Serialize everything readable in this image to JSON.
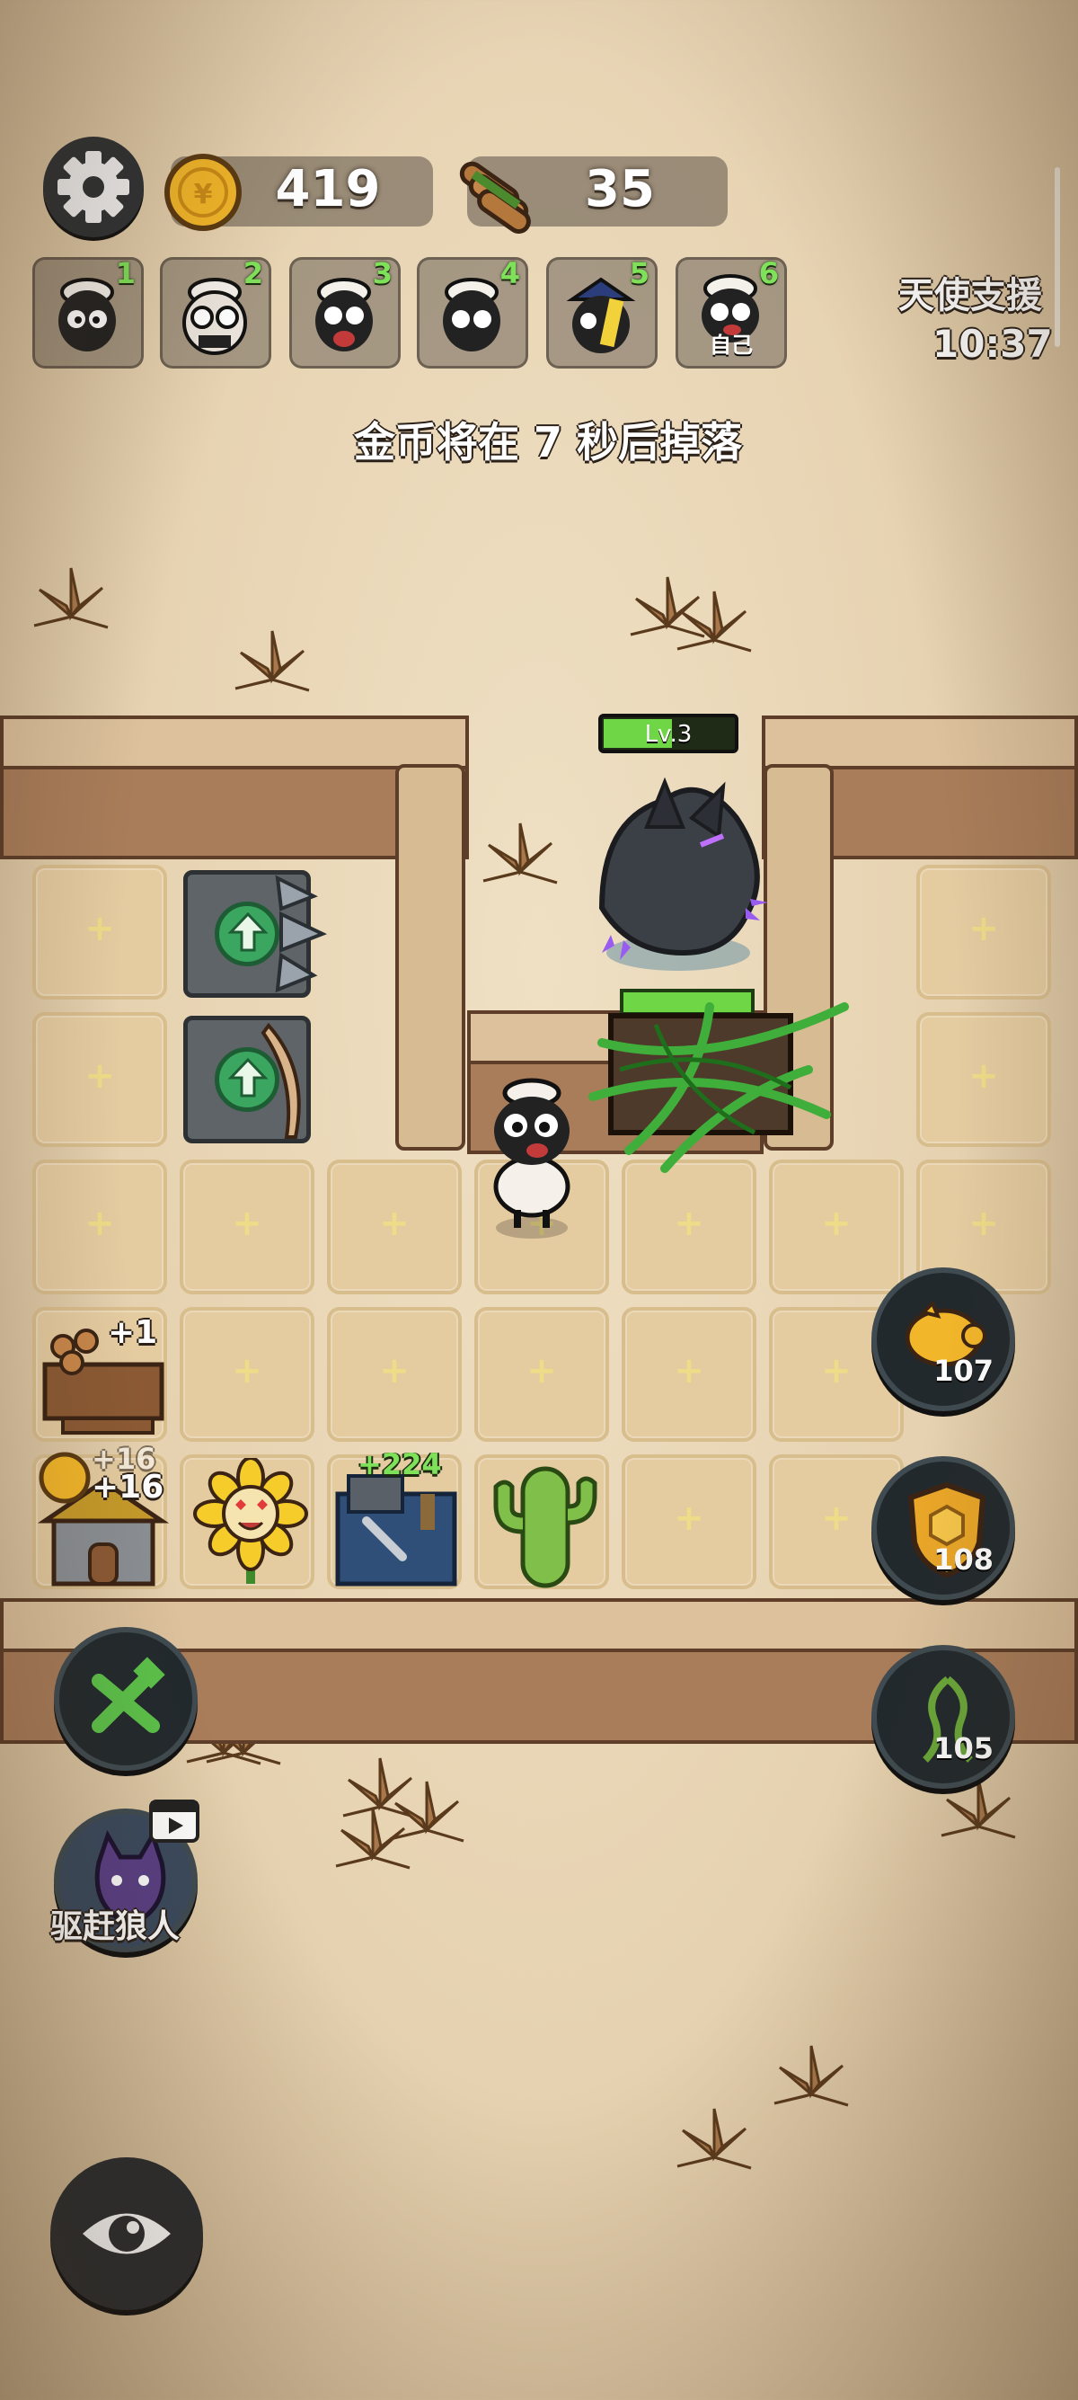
{
  "hud": {
    "gold": "419",
    "wood": "35",
    "drop_notice": "金币将在 7 秒后掉落",
    "support_label": "天使支援",
    "support_timer": "10:37"
  },
  "players": [
    {
      "num": "1",
      "self": ""
    },
    {
      "num": "2",
      "self": ""
    },
    {
      "num": "3",
      "self": ""
    },
    {
      "num": "4",
      "self": ""
    },
    {
      "num": "5",
      "self": ""
    },
    {
      "num": "6",
      "self": "自己"
    }
  ],
  "enemy": {
    "level": "Lv.3"
  },
  "board": {
    "wood_bonus": "+1",
    "gold_bonus_back": "+16",
    "gold_bonus_front": "+16",
    "repair_bonus": "+224"
  },
  "side_buttons": {
    "piggy_count": "107",
    "shield_count": "108",
    "thorn_count": "105"
  },
  "left_buttons": {
    "repel_label": "驱赶狼人"
  },
  "colors": {
    "accent_green": "#7fe05a",
    "button_dark": "#22292d",
    "sand": "#e6d2b0"
  },
  "icons": [
    "gear-icon",
    "coin-icon",
    "wood-icon",
    "piggy-bank-icon",
    "shield-icon",
    "thorn-vine-icon",
    "tools-icon",
    "video-icon",
    "eye-icon",
    "wolf-icon"
  ]
}
